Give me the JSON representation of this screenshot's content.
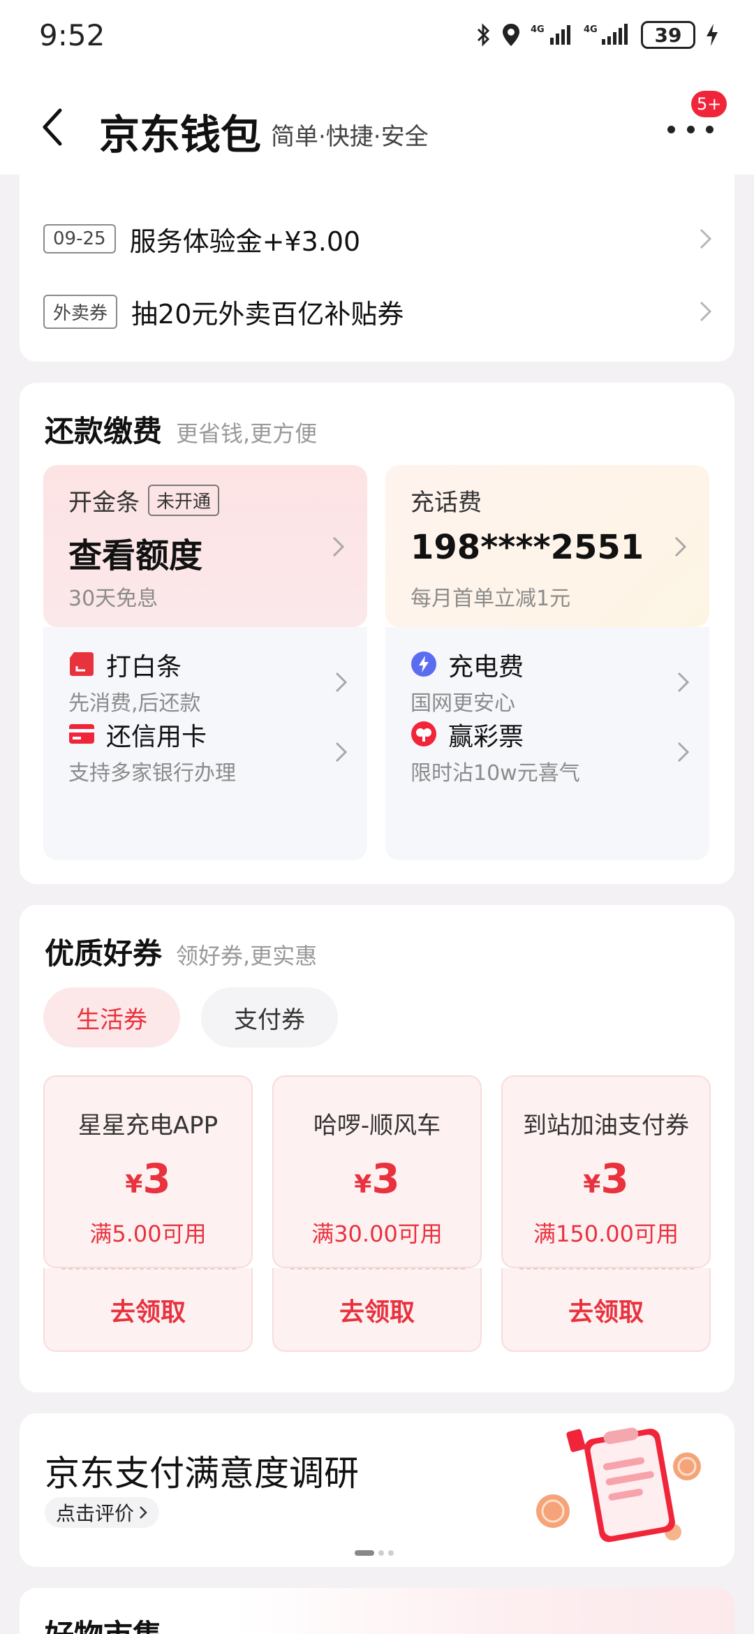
{
  "status": {
    "time": "9:52",
    "battery": "39"
  },
  "header": {
    "title": "京东钱包",
    "subtitle": "简单·快捷·安全",
    "badge": "5+"
  },
  "promos": [
    {
      "tag": "09-25",
      "text": "服务体验金+¥3.00"
    },
    {
      "tag": "外卖券",
      "text": "抽20元外卖百亿补贴券"
    }
  ],
  "repay": {
    "title": "还款缴费",
    "subtitle": "更省钱,更方便",
    "jintiao": {
      "label": "开金条",
      "tag": "未开通",
      "big": "查看额度",
      "small": "30天免息"
    },
    "phone": {
      "label": "充话费",
      "big": "198****2551",
      "small": "每月首单立减1元"
    },
    "items": [
      {
        "name": "打白条",
        "desc": "先消费,后还款",
        "icon": "baitiao-icon",
        "color": "#e8323e"
      },
      {
        "name": "充电费",
        "desc": "国网更安心",
        "icon": "lightning-icon",
        "color": "#5b6cf0"
      },
      {
        "name": "还信用卡",
        "desc": "支持多家银行办理",
        "icon": "credit-card-icon",
        "color": "#f0253a"
      },
      {
        "name": "赢彩票",
        "desc": "限时沾10w元喜气",
        "icon": "lottery-icon",
        "color": "#f0253a"
      }
    ]
  },
  "coupons": {
    "title": "优质好券",
    "subtitle": "领好券,更实惠",
    "tabs": [
      "生活券",
      "支付券"
    ],
    "currency": "¥",
    "list": [
      {
        "name": "星星充电APP",
        "amount": "3",
        "cond": "满5.00可用",
        "action": "去领取"
      },
      {
        "name": "哈啰-顺风车",
        "amount": "3",
        "cond": "满30.00可用",
        "action": "去领取"
      },
      {
        "name": "到站加油支付券",
        "amount": "3",
        "cond": "满150.00可用",
        "action": "去领取"
      }
    ]
  },
  "survey": {
    "title": "京东支付满意度调研",
    "button": "点击评价"
  },
  "market": {
    "title": "好物市集"
  },
  "colors": {
    "accent": "#e8323e",
    "badge": "#f0253a"
  }
}
